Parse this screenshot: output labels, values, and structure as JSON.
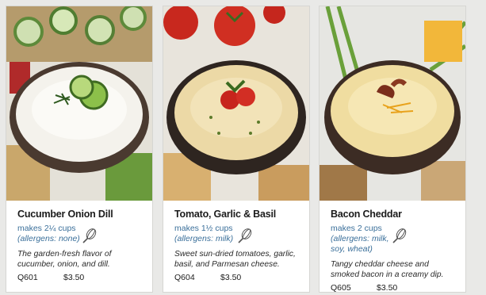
{
  "products": [
    {
      "name": "Cucumber Onion Dill",
      "yield": "makes 2¼ cups",
      "allergens": "(allergens: none)",
      "description": "The garden-fresh flavor of cucumber, onion, and dill.",
      "code": "Q601",
      "price": "$3.50",
      "icon": "whisk-icon"
    },
    {
      "name": "Tomato, Garlic & Basil",
      "yield": "makes 1½ cups",
      "allergens": "(allergens: milk)",
      "description": "Sweet sun-dried tomatoes, garlic, basil, and Parmesan cheese.",
      "code": "Q604",
      "price": "$3.50",
      "icon": "whisk-icon"
    },
    {
      "name": "Bacon Cheddar",
      "yield": "makes 2 cups",
      "allergens": "(allergens: milk, soy, wheat)",
      "description": "Tangy cheddar cheese and smoked bacon in a creamy dip.",
      "code": "Q605",
      "price": "$3.50",
      "icon": "whisk-icon"
    }
  ],
  "colors": {
    "accent": "#3a6f9a",
    "text": "#1b1b1b"
  }
}
